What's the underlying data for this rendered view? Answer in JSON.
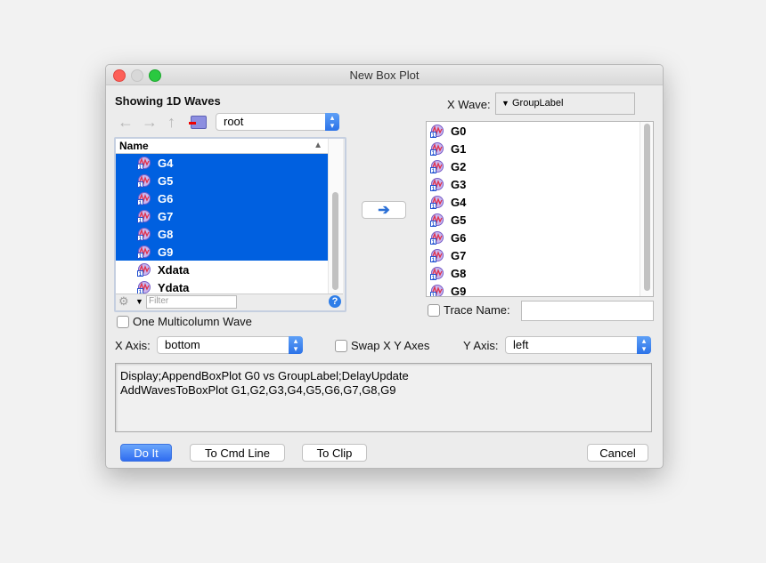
{
  "window": {
    "title": "New Box Plot"
  },
  "left": {
    "heading": "Showing 1D Waves",
    "folder": "root",
    "list_header": "Name",
    "items": [
      {
        "name": "G4",
        "selected": true
      },
      {
        "name": "G5",
        "selected": true
      },
      {
        "name": "G6",
        "selected": true
      },
      {
        "name": "G7",
        "selected": true
      },
      {
        "name": "G8",
        "selected": true
      },
      {
        "name": "G9",
        "selected": true
      },
      {
        "name": "Xdata",
        "selected": false
      },
      {
        "name": "Ydata",
        "selected": false
      }
    ],
    "filter_placeholder": "Filter",
    "one_multicolumn_label": "One Multicolumn Wave"
  },
  "right": {
    "xwave_label": "X Wave:",
    "xwave_value": "GroupLabel",
    "items": [
      "G0",
      "G1",
      "G2",
      "G3",
      "G4",
      "G5",
      "G6",
      "G7",
      "G8",
      "G9"
    ],
    "trace_name_label": "Trace Name:",
    "trace_name_value": ""
  },
  "axes": {
    "x_label": "X Axis:",
    "x_value": "bottom",
    "swap_label": "Swap X Y Axes",
    "y_label": "Y Axis:",
    "y_value": "left"
  },
  "command": {
    "line1": "Display;AppendBoxPlot G0 vs GroupLabel;DelayUpdate",
    "line2": "AddWavesToBoxPlot G1,G2,G3,G4,G5,G6,G7,G8,G9"
  },
  "buttons": {
    "do_it": "Do It",
    "to_cmd": "To Cmd Line",
    "to_clip": "To Clip",
    "cancel": "Cancel"
  }
}
